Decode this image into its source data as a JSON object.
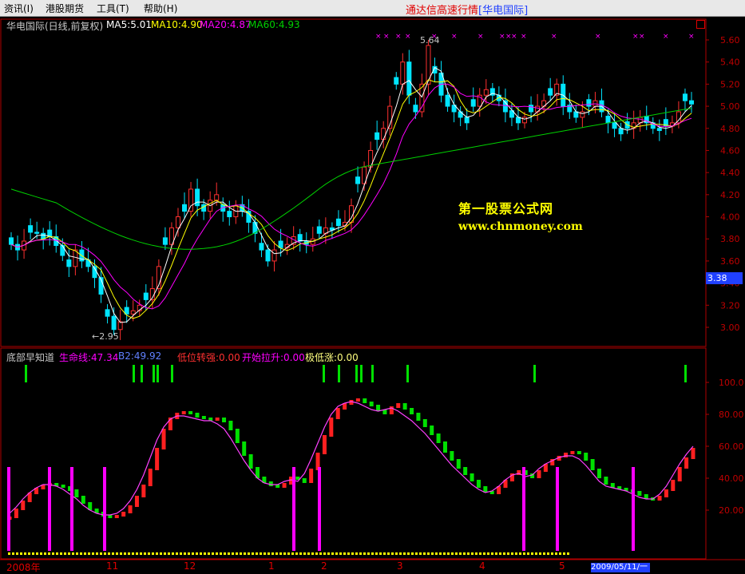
{
  "menu": [
    {
      "label": "资讯(I)",
      "x": 5
    },
    {
      "label": "港股期货",
      "x": 57
    },
    {
      "label": "工具(T)",
      "x": 121
    },
    {
      "label": "帮助(H)",
      "x": 180
    }
  ],
  "app_title": "通达信高速行情",
  "app_title_ex": "[华电国际]",
  "upper": {
    "name": "华电国际(日线,前复权)",
    "ma5": "MA5:5.01",
    "ma10": "MA10:4.90",
    "ma20": "MA20:4.87",
    "ma60": "MA60:4.93",
    "high_label": "5.64",
    "low_label": "2.95",
    "current_price": "3.38"
  },
  "lower": {
    "name": "底部早知道",
    "l1": "生命线:47.34",
    "l2": "B2:49.92",
    "l3": "低位转强:0.00",
    "l4": "开始拉升:0.00",
    "l5": "极低涨:0.00"
  },
  "watermark": {
    "line1": "第一股票公式网",
    "line2": "www.chnmoney.com"
  },
  "dates": {
    "d1": "2008年",
    "d2": "11",
    "d3": "12",
    "d4": "1",
    "d5": "2",
    "d6": "3",
    "d7": "4",
    "d8": "5",
    "end": "2009/05/11/一"
  },
  "colors": {
    "up": "#ff3030",
    "down": "#00e5ff",
    "ma5": "#ffffff",
    "ma10": "#ffff00",
    "ma20": "#ff00ff",
    "ma60": "#00d000",
    "axis": "#b00000"
  },
  "chart_data": [
    {
      "type": "candlestick",
      "axis_ticks": [
        "5.60",
        "5.40",
        "5.20",
        "5.00",
        "4.80",
        "4.60",
        "4.40",
        "4.20",
        "4.00",
        "3.80",
        "3.60",
        "3.40",
        "3.20",
        "3.00"
      ],
      "ylim": [
        2.9,
        5.7
      ],
      "ma_labels": [
        "MA5:5.01",
        "MA10:4.90",
        "MA20:4.87",
        "MA60:4.93"
      ],
      "close_points": [
        3.75,
        3.7,
        3.78,
        3.86,
        3.85,
        3.8,
        3.82,
        3.74,
        3.65,
        3.55,
        3.7,
        3.6,
        3.55,
        3.45,
        3.3,
        3.1,
        2.98,
        3.05,
        3.12,
        3.15,
        3.2,
        3.25,
        3.35,
        3.55,
        3.75,
        3.9,
        4.0,
        4.05,
        4.25,
        4.1,
        4.05,
        4.15,
        4.2,
        4.05,
        4.0,
        4.1,
        4.05,
        3.95,
        3.85,
        3.7,
        3.6,
        3.7,
        3.72,
        3.75,
        3.82,
        3.78,
        3.75,
        3.8,
        3.85,
        3.9,
        3.88,
        3.92,
        3.95,
        4.1,
        4.3,
        4.45,
        4.6,
        4.7,
        4.8,
        5.0,
        5.2,
        5.4,
        5.1,
        4.95,
        5.2,
        5.55,
        5.3,
        5.1,
        5.0,
        4.95,
        4.9,
        4.85,
        5.0,
        5.1,
        5.15,
        5.1,
        5.05,
        4.95,
        4.9,
        4.85,
        4.9,
        4.95,
        5.0,
        5.05,
        5.1,
        5.2,
        5.0,
        4.95,
        4.9,
        4.95,
        5.0,
        5.05,
        4.95,
        4.85,
        4.8,
        4.75,
        4.8,
        4.85,
        4.9,
        4.85,
        4.8,
        4.78,
        4.82,
        4.85,
        4.95,
        5.05,
        5.02
      ]
    },
    {
      "type": "bar",
      "axis_ticks": [
        "100.0",
        "80.00",
        "60.00",
        "40.00",
        "20.00"
      ],
      "ylim": [
        0,
        120
      ],
      "series": [
        {
          "name": "生命线",
          "values": [
            15,
            20,
            25,
            30,
            33,
            35,
            36,
            35,
            34,
            32,
            28,
            24,
            20,
            18,
            16,
            15,
            16,
            18,
            22,
            28,
            35,
            45,
            58,
            70,
            77,
            80,
            81,
            80,
            78,
            77,
            76,
            77,
            75,
            70,
            62,
            54,
            46,
            40,
            37,
            35,
            34,
            36,
            40,
            39,
            37,
            45,
            55,
            66,
            77,
            83,
            86,
            88,
            89,
            87,
            85,
            82,
            80,
            84,
            86,
            83,
            80,
            76,
            72,
            67,
            62,
            56,
            51,
            46,
            42,
            38,
            34,
            31,
            30,
            34,
            38,
            42,
            44,
            42,
            40,
            44,
            48,
            51,
            53,
            55,
            56,
            55,
            51,
            45,
            40,
            36,
            34,
            33,
            32,
            31,
            29,
            27,
            26,
            28,
            32,
            38,
            46,
            52,
            58
          ]
        },
        {
          "name": "B2",
          "values": [
            18,
            22,
            27,
            31,
            34,
            36,
            36,
            35,
            33,
            30,
            27,
            23,
            20,
            18,
            17,
            17,
            18,
            21,
            26,
            33,
            42,
            53,
            64,
            72,
            77,
            79,
            79,
            78,
            77,
            76,
            76,
            74,
            71,
            65,
            58,
            51,
            45,
            40,
            37,
            36,
            36,
            38,
            39,
            38,
            43,
            52,
            62,
            72,
            80,
            85,
            87,
            88,
            87,
            85,
            83,
            82,
            83,
            84,
            82,
            79,
            76,
            72,
            68,
            63,
            58,
            53,
            48,
            44,
            40,
            36,
            33,
            31,
            32,
            35,
            39,
            42,
            43,
            41,
            42,
            46,
            49,
            51,
            53,
            54,
            54,
            52,
            48,
            43,
            38,
            35,
            34,
            33,
            32,
            30,
            28,
            27,
            27,
            30,
            35,
            42,
            49,
            55,
            60
          ]
        }
      ]
    }
  ]
}
